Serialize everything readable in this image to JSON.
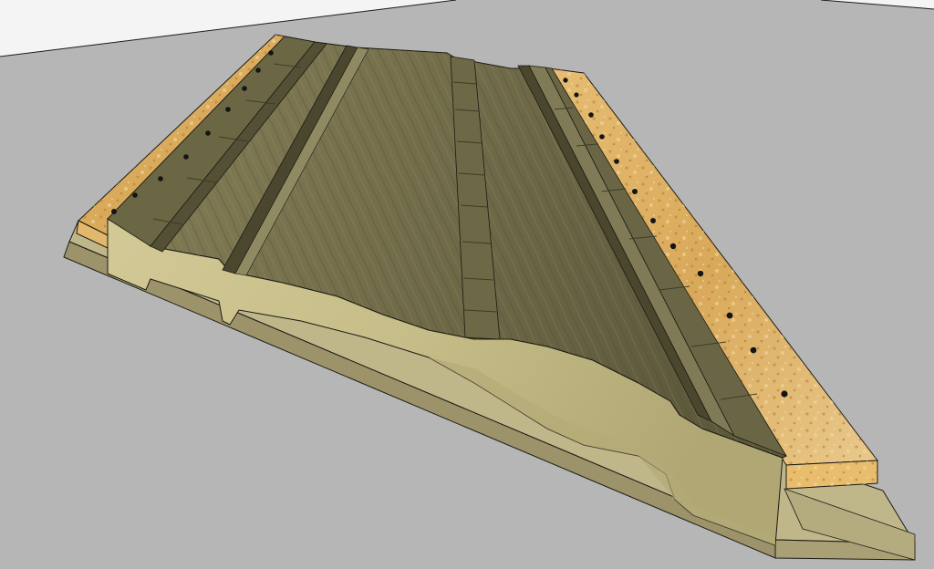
{
  "scene": {
    "subject": "3d-model-wood-molding-panel",
    "colors": {
      "sky": "#f4f4f4",
      "ground": "#b6b6b6",
      "horizon_line": "#1c1c1c",
      "osb_light": "#e8c27a",
      "osb_dark": "#c58e3f",
      "wood_light": "#8e8862",
      "wood_mid": "#6e6a48",
      "wood_dark": "#4d4a30",
      "profile_face": "#c9c08a",
      "profile_shadow": "#a89f6a",
      "base_board": "#bfb68a",
      "base_board_dark": "#9c936a",
      "edge_line": "#1a1a14",
      "hole": "#141414"
    },
    "icons": {
      "nail_hole": "nail-hole-icon"
    }
  }
}
